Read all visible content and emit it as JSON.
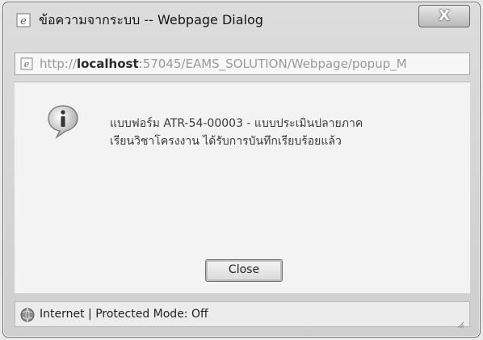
{
  "window": {
    "title": "ข้อความจากระบบ -- Webpage Dialog",
    "close_glyph": "X"
  },
  "address": {
    "url_prefix": "http://",
    "url_host": "localhost",
    "url_rest": ":57045/EAMS_SOLUTION/Webpage/popup_M"
  },
  "dialog": {
    "icon": "info-icon",
    "message_line1": "แบบฟอร์ม ATR-54-00003 - แบบประเมินปลายภาค",
    "message_line2": "เรียนวิชาโครงงาน ได้รับการบันทึกเรียบร้อยแล้ว",
    "close_label": "Close"
  },
  "status": {
    "text": "Internet | Protected Mode: Off",
    "icon": "globe-icon"
  },
  "colors": {
    "chrome": "#d6d6d6",
    "content_bg": "#f3f3f3",
    "text": "#222222"
  }
}
